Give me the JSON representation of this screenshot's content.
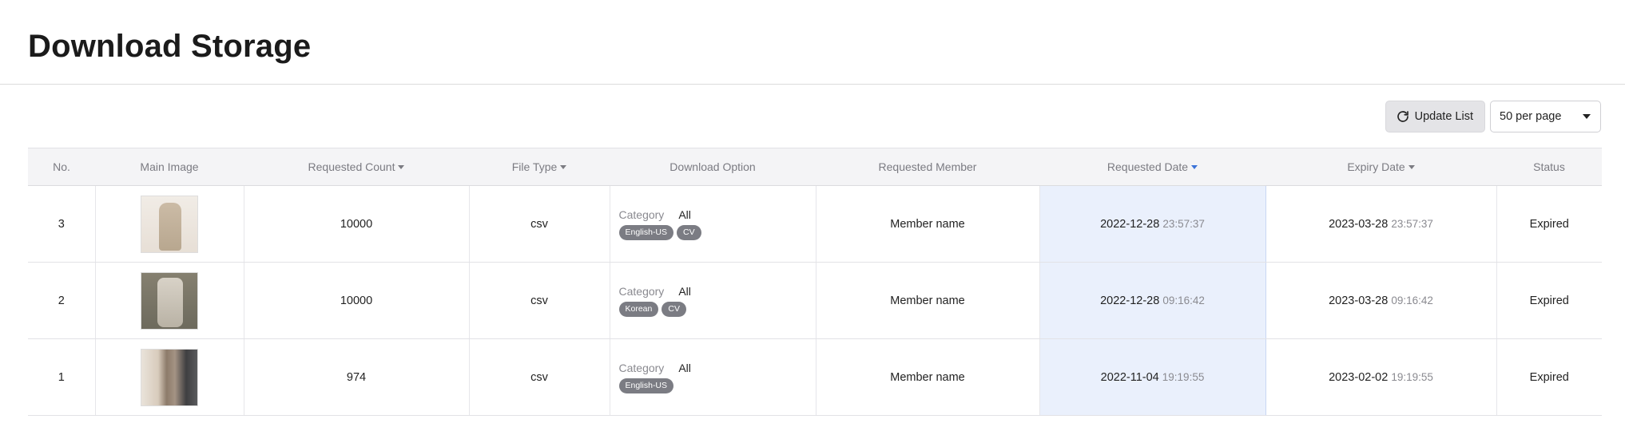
{
  "page": {
    "title": "Download Storage"
  },
  "toolbar": {
    "update_label": "Update List",
    "per_page": "50 per page"
  },
  "columns": {
    "no": "No.",
    "image": "Main Image",
    "count": "Requested Count",
    "type": "File Type",
    "option": "Download Option",
    "member": "Requested Member",
    "requested_date": "Requested Date",
    "expiry_date": "Expiry Date",
    "status": "Status"
  },
  "option_label": "Category",
  "rows": [
    {
      "no": "3",
      "count": "10000",
      "type": "csv",
      "category": "All",
      "chips": [
        "English-US",
        "CV"
      ],
      "member": "Member name",
      "req_date": "2022-12-28",
      "req_time": "23:57:37",
      "exp_date": "2023-03-28",
      "exp_time": "23:57:37",
      "status": "Expired"
    },
    {
      "no": "2",
      "count": "10000",
      "type": "csv",
      "category": "All",
      "chips": [
        "Korean",
        "CV"
      ],
      "member": "Member name",
      "req_date": "2022-12-28",
      "req_time": "09:16:42",
      "exp_date": "2023-03-28",
      "exp_time": "09:16:42",
      "status": "Expired"
    },
    {
      "no": "1",
      "count": "974",
      "type": "csv",
      "category": "All",
      "chips": [
        "English-US"
      ],
      "member": "Member name",
      "req_date": "2022-11-04",
      "req_time": "19:19:55",
      "exp_date": "2023-02-02",
      "exp_time": "19:19:55",
      "status": "Expired"
    }
  ],
  "colors": {
    "accent": "#3b73d8",
    "active_column_bg": "#eaf0fc",
    "chip_bg": "#7b7c83"
  }
}
